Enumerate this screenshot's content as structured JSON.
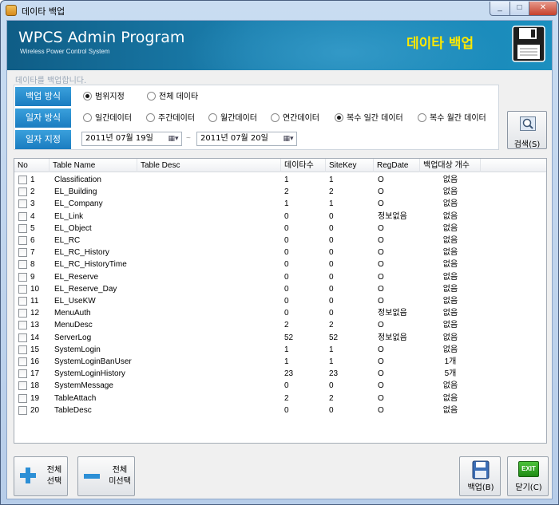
{
  "window": {
    "title": "데이타 백업",
    "min_glyph": "_",
    "max_glyph": "□",
    "close_glyph": "✕"
  },
  "banner": {
    "app_title": "WPCS Admin Program",
    "app_subtitle": "Wireless Power Control System",
    "headline": "데이타 백업"
  },
  "subtitle": "데이타를 백업합니다.",
  "options": {
    "backup_mode": {
      "label": "백업 방식",
      "choices": [
        {
          "label": "범위지정",
          "selected": true
        },
        {
          "label": "전체 데이타",
          "selected": false
        }
      ]
    },
    "date_mode": {
      "label": "일자 방식",
      "choices": [
        {
          "label": "일간데이터",
          "selected": false
        },
        {
          "label": "주간데이터",
          "selected": false
        },
        {
          "label": "월간데이터",
          "selected": false
        },
        {
          "label": "연간데이터",
          "selected": false
        },
        {
          "label": "복수 일간 데이터",
          "selected": true
        },
        {
          "label": "복수 월간 데이터",
          "selected": false
        }
      ]
    },
    "date_range": {
      "label": "일자 지정",
      "start": "2011년 07월 19일",
      "separator": "~",
      "end": "2011년 07월 20일",
      "calendar_glyph": "▦▾"
    }
  },
  "search_button": {
    "label": "검색(S)",
    "icon": "magnifier-icon"
  },
  "table": {
    "columns": [
      "No",
      "Table Name",
      "Table Desc",
      "데이타수",
      "SiteKey",
      "RegDate",
      "백업대상 개수"
    ],
    "rows": [
      {
        "no": "1",
        "name": "Classification",
        "desc": "",
        "count": "1",
        "sitekey": "1",
        "regdate": "O",
        "target": "없음"
      },
      {
        "no": "2",
        "name": "EL_Building",
        "desc": "",
        "count": "2",
        "sitekey": "2",
        "regdate": "O",
        "target": "없음"
      },
      {
        "no": "3",
        "name": "EL_Company",
        "desc": "",
        "count": "1",
        "sitekey": "1",
        "regdate": "O",
        "target": "없음"
      },
      {
        "no": "4",
        "name": "EL_Link",
        "desc": "",
        "count": "0",
        "sitekey": "0",
        "regdate": "정보없음",
        "target": "없음"
      },
      {
        "no": "5",
        "name": "EL_Object",
        "desc": "",
        "count": "0",
        "sitekey": "0",
        "regdate": "O",
        "target": "없음"
      },
      {
        "no": "6",
        "name": "EL_RC",
        "desc": "",
        "count": "0",
        "sitekey": "0",
        "regdate": "O",
        "target": "없음"
      },
      {
        "no": "7",
        "name": "EL_RC_History",
        "desc": "",
        "count": "0",
        "sitekey": "0",
        "regdate": "O",
        "target": "없음"
      },
      {
        "no": "8",
        "name": "EL_RC_HistoryTime",
        "desc": "",
        "count": "0",
        "sitekey": "0",
        "regdate": "O",
        "target": "없음"
      },
      {
        "no": "9",
        "name": "EL_Reserve",
        "desc": "",
        "count": "0",
        "sitekey": "0",
        "regdate": "O",
        "target": "없음"
      },
      {
        "no": "10",
        "name": "EL_Reserve_Day",
        "desc": "",
        "count": "0",
        "sitekey": "0",
        "regdate": "O",
        "target": "없음"
      },
      {
        "no": "11",
        "name": "EL_UseKW",
        "desc": "",
        "count": "0",
        "sitekey": "0",
        "regdate": "O",
        "target": "없음"
      },
      {
        "no": "12",
        "name": "MenuAuth",
        "desc": "",
        "count": "0",
        "sitekey": "0",
        "regdate": "정보없음",
        "target": "없음"
      },
      {
        "no": "13",
        "name": "MenuDesc",
        "desc": "",
        "count": "2",
        "sitekey": "2",
        "regdate": "O",
        "target": "없음"
      },
      {
        "no": "14",
        "name": "ServerLog",
        "desc": "",
        "count": "52",
        "sitekey": "52",
        "regdate": "정보없음",
        "target": "없음"
      },
      {
        "no": "15",
        "name": "SystemLogin",
        "desc": "",
        "count": "1",
        "sitekey": "1",
        "regdate": "O",
        "target": "없음"
      },
      {
        "no": "16",
        "name": "SystemLoginBanUser",
        "desc": "",
        "count": "1",
        "sitekey": "1",
        "regdate": "O",
        "target": "1개"
      },
      {
        "no": "17",
        "name": "SystemLoginHistory",
        "desc": "",
        "count": "23",
        "sitekey": "23",
        "regdate": "O",
        "target": "5개"
      },
      {
        "no": "18",
        "name": "SystemMessage",
        "desc": "",
        "count": "0",
        "sitekey": "0",
        "regdate": "O",
        "target": "없음"
      },
      {
        "no": "19",
        "name": "TableAttach",
        "desc": "",
        "count": "2",
        "sitekey": "2",
        "regdate": "O",
        "target": "없음"
      },
      {
        "no": "20",
        "name": "TableDesc",
        "desc": "",
        "count": "0",
        "sitekey": "0",
        "regdate": "O",
        "target": "없음"
      }
    ]
  },
  "buttons": {
    "select_all": {
      "line1": "전체",
      "line2": "선택"
    },
    "deselect_all": {
      "line1": "전체",
      "line2": "미선택"
    },
    "backup": {
      "label": "백업(B)"
    },
    "close": {
      "label": "닫기(C)",
      "icon_text": "EXIT"
    }
  }
}
